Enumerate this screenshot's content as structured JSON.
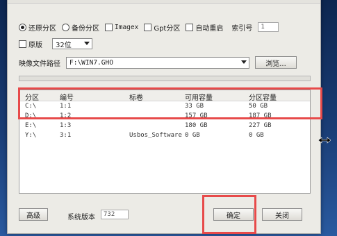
{
  "options": {
    "restore_label": "还原分区",
    "backup_label": "备份分区",
    "imagex_label": "Imagex",
    "gpt_label": "Gpt分区",
    "auto_restart_label": "自动重启",
    "index_label": "索引号",
    "index_value": "1",
    "original_label": "原版",
    "bitness_value": "32位"
  },
  "image_path": {
    "label": "映像文件路径",
    "value": "F:\\WIN7.GHO",
    "browse_label": "浏览..."
  },
  "table": {
    "headers": [
      "分区",
      "编号",
      "标卷",
      "可用容量",
      "分区容量"
    ],
    "rows": [
      [
        "C:\\",
        "1:1",
        "",
        "33 GB",
        "50 GB"
      ],
      [
        "D:\\",
        "1:2",
        "",
        "157 GB",
        "187 GB"
      ],
      [
        "E:\\",
        "1:3",
        "",
        "180 GB",
        "227 GB"
      ],
      [
        "Y:\\",
        "3:1",
        "Usbos_Software",
        "0 GB",
        "0 GB"
      ]
    ]
  },
  "footer": {
    "advanced_label": "高级",
    "version_label": "系统版本",
    "version_value": "732",
    "ok_label": "确定",
    "close_label": "关闭"
  },
  "colors": {
    "highlight": "#e74a4a",
    "dialog_bg": "#ecebe6"
  },
  "icons": [
    "chevron-down-icon",
    "resize-horizontal-icon"
  ]
}
